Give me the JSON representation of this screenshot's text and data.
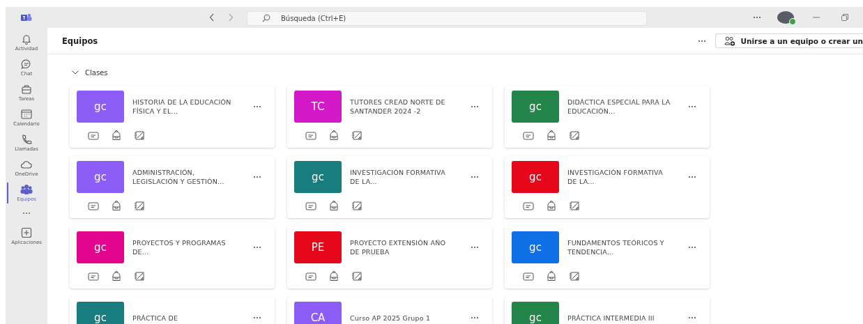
{
  "titlebar": {
    "search": {
      "placeholder": "Búsqueda (Ctrl+E)"
    }
  },
  "rail": [
    {
      "label": "Actividad",
      "selected": false
    },
    {
      "label": "Chat",
      "selected": false
    },
    {
      "label": "Tareas",
      "selected": false
    },
    {
      "label": "Calendario",
      "selected": false
    },
    {
      "label": "Llamadas",
      "selected": false
    },
    {
      "label": "OneDrive",
      "selected": false
    },
    {
      "label": "Equipos",
      "selected": true
    },
    {
      "label": "Aplicaciones",
      "selected": false
    }
  ],
  "header": {
    "title": "Equipos",
    "join_button": "Unirse a un equipo o crear un"
  },
  "section": {
    "title": "Clases",
    "expanded": true
  },
  "teams": [
    {
      "initials": "gc",
      "name": "HISTORIA DE LA EDUCACIÓN FÍSICA Y EL...",
      "color": "#8b5cf6"
    },
    {
      "initials": "TC",
      "name": "TUTORES CREAD NORTE DE SANTANDER 2024 -2",
      "color": "#d319c8"
    },
    {
      "initials": "gc",
      "name": "DIDÁCTICA ESPECIAL PARA LA EDUCACIÓN...",
      "color": "#24854b"
    },
    {
      "initials": "gc",
      "name": "ADMINISTRACIÓN, LEGISLACIÓN Y GESTIÓN...",
      "color": "#8b5cf6"
    },
    {
      "initials": "gc",
      "name": "INVESTIGACIÓN FORMATIVA DE LA...",
      "color": "#1a7d7d"
    },
    {
      "initials": "gc",
      "name": "INVESTIGACIÓN FORMATIVA DE LA...",
      "color": "#e6081a"
    },
    {
      "initials": "gc",
      "name": "PROYECTOS Y PROGRAMAS DE...",
      "color": "#e3058e"
    },
    {
      "initials": "PE",
      "name": "PROYECTO EXTENSIÓN AÑO DE PRUEBA",
      "color": "#e6081a"
    },
    {
      "initials": "gc",
      "name": "FUNDAMENTOS TEÓRICOS Y TENDENCIA...",
      "color": "#0f6fe6"
    },
    {
      "initials": "gc",
      "name": "PRÁCTICA DE",
      "color": "#1a7d7d"
    },
    {
      "initials": "CA",
      "name": "Curso AP 2025 Grupo 1",
      "color": "#8b5cf6"
    },
    {
      "initials": "gc",
      "name": "PRÁCTICA INTERMEDIA III",
      "color": "#24854b"
    }
  ]
}
